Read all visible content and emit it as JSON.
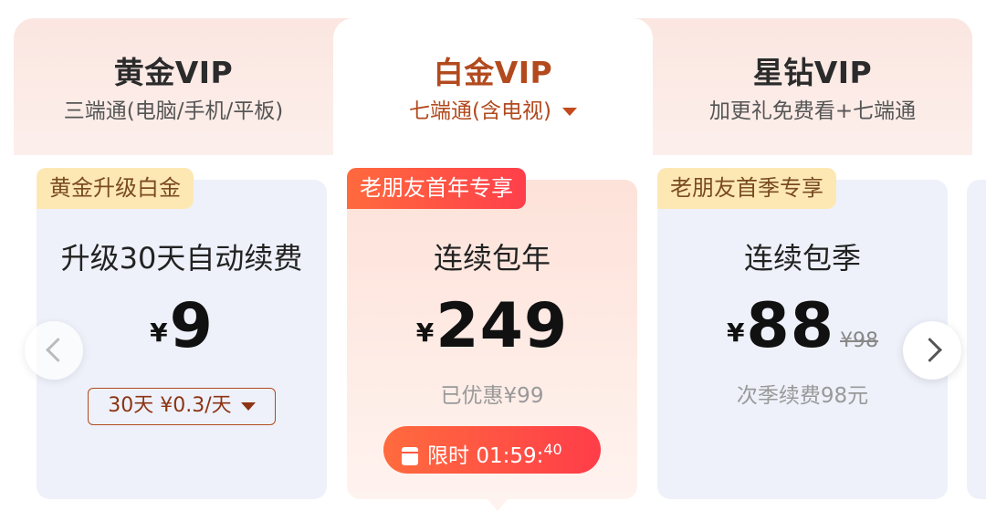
{
  "tabs": [
    {
      "title": "黄金VIP",
      "subtitle": "三端通(电脑/手机/平板)"
    },
    {
      "title": "白金VIP",
      "subtitle": "七端通(含电视)"
    },
    {
      "title": "星钻VIP",
      "subtitle": "加更礼免费看+七端通"
    }
  ],
  "cards": [
    {
      "badge": "黄金升级白金",
      "name": "升级30天自动续费",
      "currency": "¥",
      "price": "9",
      "period_option": "30天 ¥0.3/天"
    },
    {
      "badge": "老朋友首年专享",
      "name": "连续包年",
      "currency": "¥",
      "price": "249",
      "note": "已优惠¥99",
      "timer_label": "限时",
      "timer_time": "01:59:",
      "timer_seconds": "40"
    },
    {
      "badge": "老朋友首季专享",
      "name": "连续包季",
      "currency": "¥",
      "price": "88",
      "original_price": "¥98",
      "note": "次季续费98元"
    }
  ],
  "colors": {
    "accent": "#b24a1e",
    "badge_red": "#ff4b45",
    "badge_gold": "#fde8b4"
  }
}
